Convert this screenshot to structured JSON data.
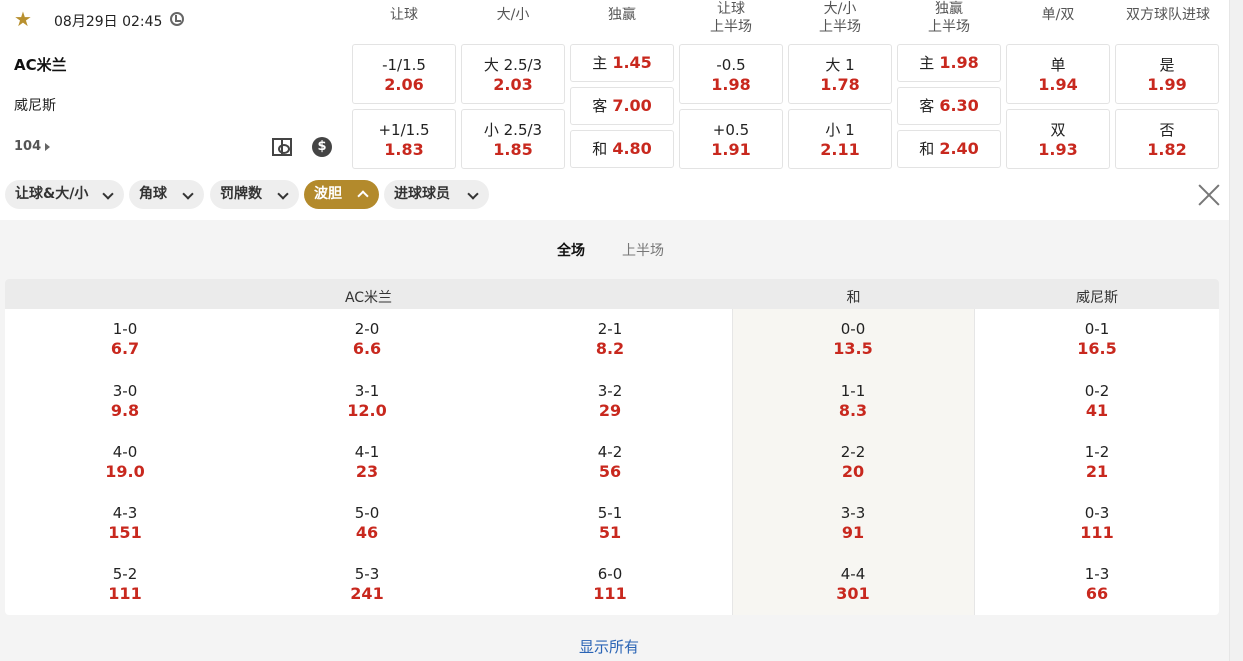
{
  "match": {
    "time": "08月29日 02:45",
    "home": "AC米兰",
    "away": "威尼斯",
    "more_count": "104"
  },
  "columns": [
    {
      "line1": "让球",
      "line2": ""
    },
    {
      "line1": "大/小",
      "line2": ""
    },
    {
      "line1": "独赢",
      "line2": ""
    },
    {
      "line1": "让球",
      "line2": "上半场"
    },
    {
      "line1": "大/小",
      "line2": "上半场"
    },
    {
      "line1": "独赢",
      "line2": "上半场"
    },
    {
      "line1": "单/双",
      "line2": ""
    },
    {
      "line1": "双方球队进球",
      "line2": ""
    }
  ],
  "markets": {
    "handicap": [
      {
        "label": "-1/1.5",
        "odd": "2.06"
      },
      {
        "label": "+1/1.5",
        "odd": "1.83"
      }
    ],
    "total": [
      {
        "label": "大 2.5/3",
        "odd": "2.03"
      },
      {
        "label": "小 2.5/3",
        "odd": "1.85"
      }
    ],
    "moneyline": [
      {
        "label": "主",
        "odd": "1.45"
      },
      {
        "label": "客",
        "odd": "7.00"
      },
      {
        "label": "和",
        "odd": "4.80"
      }
    ],
    "handicap_1h": [
      {
        "label": "-0.5",
        "odd": "1.98"
      },
      {
        "label": "+0.5",
        "odd": "1.91"
      }
    ],
    "total_1h": [
      {
        "label": "大 1",
        "odd": "1.78"
      },
      {
        "label": "小 1",
        "odd": "2.11"
      }
    ],
    "moneyline_1h": [
      {
        "label": "主",
        "odd": "1.98"
      },
      {
        "label": "客",
        "odd": "6.30"
      },
      {
        "label": "和",
        "odd": "2.40"
      }
    ],
    "odd_even": [
      {
        "label": "单",
        "odd": "1.94"
      },
      {
        "label": "双",
        "odd": "1.93"
      }
    ],
    "btts": [
      {
        "label": "是",
        "odd": "1.99"
      },
      {
        "label": "否",
        "odd": "1.82"
      }
    ]
  },
  "filters": [
    {
      "label": "让球&大/小",
      "active": false
    },
    {
      "label": "角球",
      "active": false
    },
    {
      "label": "罚牌数",
      "active": false
    },
    {
      "label": "波胆",
      "active": true
    },
    {
      "label": "进球球员",
      "active": false
    }
  ],
  "period_tabs": [
    {
      "label": "全场",
      "active": true
    },
    {
      "label": "上半场",
      "active": false
    }
  ],
  "correct_score": {
    "home_header": "AC米兰",
    "draw_header": "和",
    "away_header": "威尼斯",
    "home": [
      [
        {
          "score": "1-0",
          "odd": "6.7"
        },
        {
          "score": "2-0",
          "odd": "6.6"
        },
        {
          "score": "2-1",
          "odd": "8.2"
        }
      ],
      [
        {
          "score": "3-0",
          "odd": "9.8"
        },
        {
          "score": "3-1",
          "odd": "12.0"
        },
        {
          "score": "3-2",
          "odd": "29"
        }
      ],
      [
        {
          "score": "4-0",
          "odd": "19.0"
        },
        {
          "score": "4-1",
          "odd": "23"
        },
        {
          "score": "4-2",
          "odd": "56"
        }
      ],
      [
        {
          "score": "4-3",
          "odd": "151"
        },
        {
          "score": "5-0",
          "odd": "46"
        },
        {
          "score": "5-1",
          "odd": "51"
        }
      ],
      [
        {
          "score": "5-2",
          "odd": "111"
        },
        {
          "score": "5-3",
          "odd": "241"
        },
        {
          "score": "6-0",
          "odd": "111"
        }
      ]
    ],
    "draw": [
      {
        "score": "0-0",
        "odd": "13.5"
      },
      {
        "score": "1-1",
        "odd": "8.3"
      },
      {
        "score": "2-2",
        "odd": "20"
      },
      {
        "score": "3-3",
        "odd": "91"
      },
      {
        "score": "4-4",
        "odd": "301"
      }
    ],
    "away": [
      {
        "score": "0-1",
        "odd": "16.5"
      },
      {
        "score": "0-2",
        "odd": "41"
      },
      {
        "score": "1-2",
        "odd": "21"
      },
      {
        "score": "0-3",
        "odd": "111"
      },
      {
        "score": "1-3",
        "odd": "66"
      }
    ]
  },
  "show_all_label": "显示所有"
}
